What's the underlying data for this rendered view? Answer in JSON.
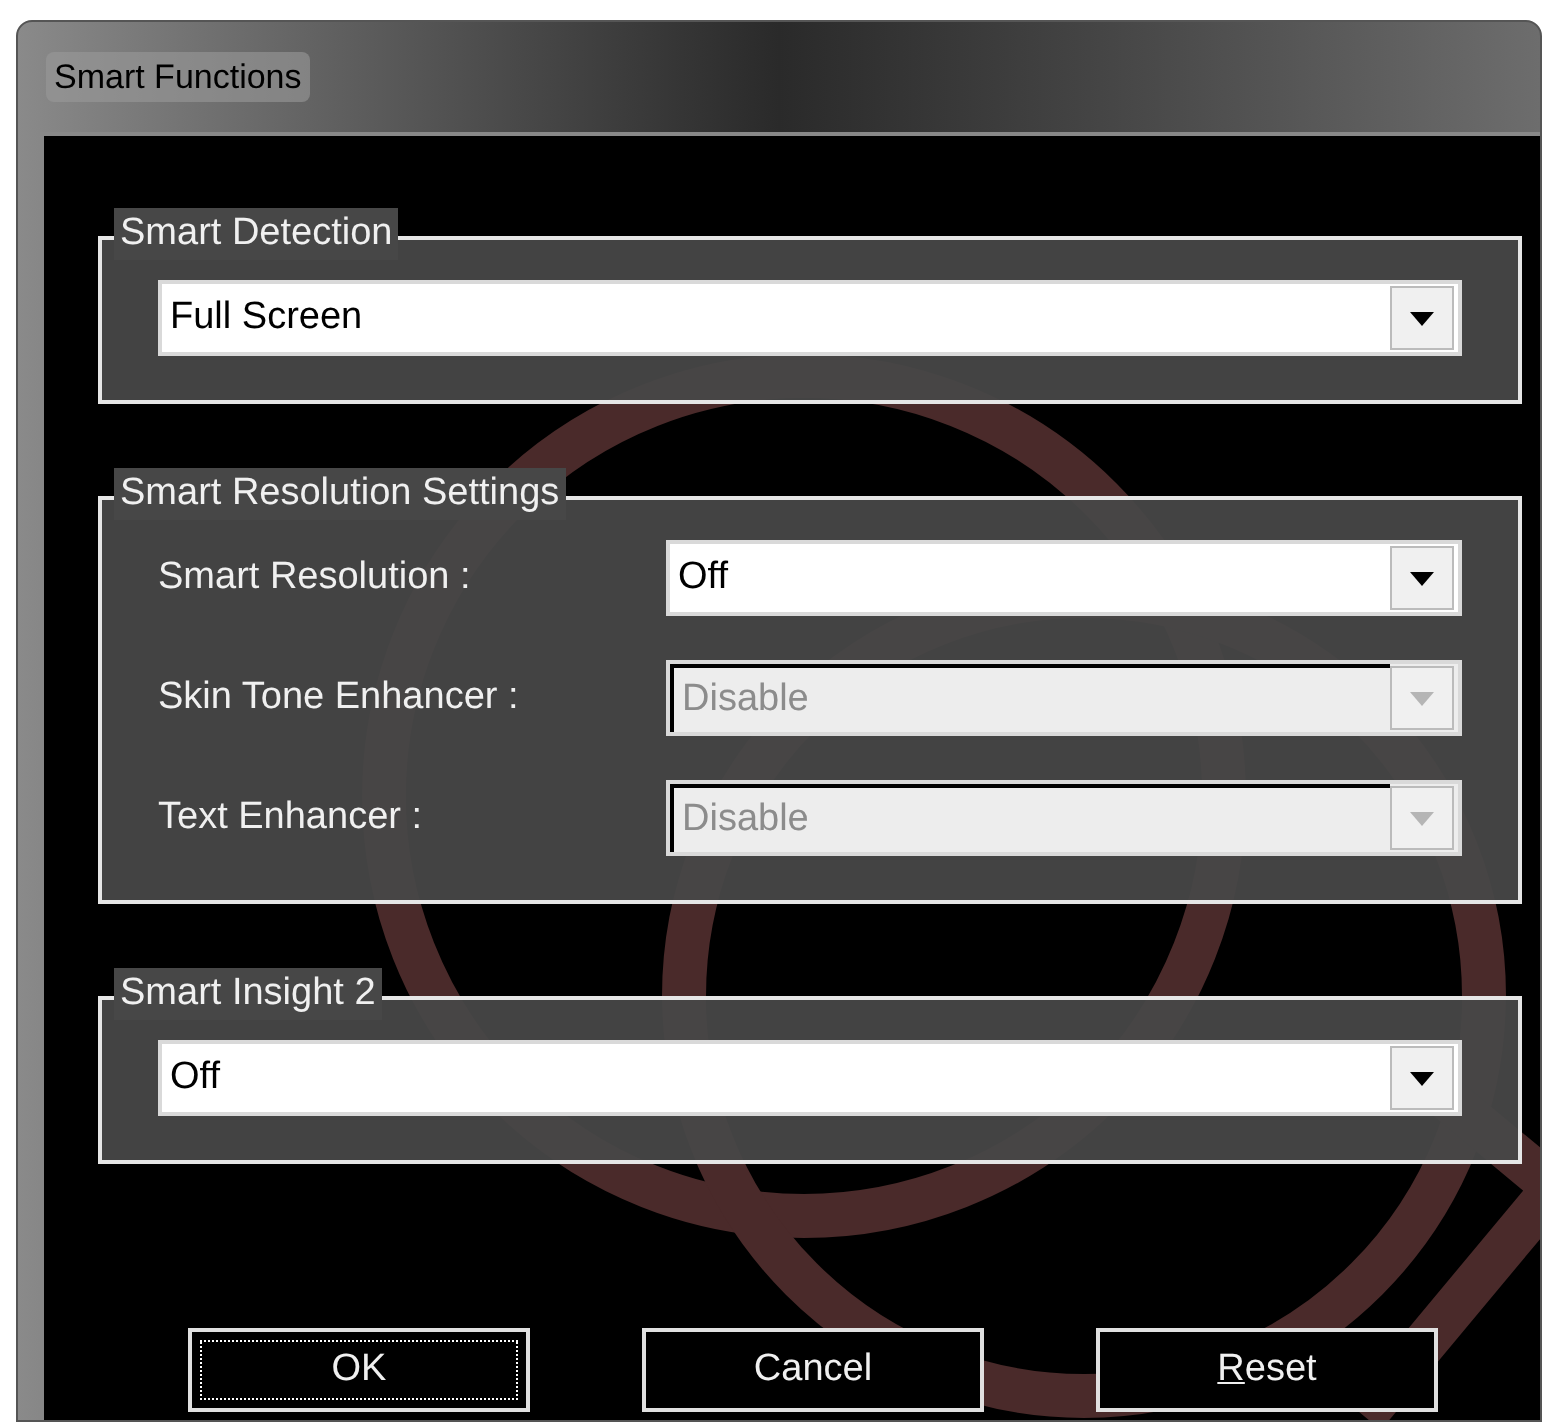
{
  "window": {
    "title": "Smart Functions"
  },
  "groups": [
    {
      "title": "Smart Detection",
      "rows": [
        {
          "value": "Full Screen",
          "disabled": false
        }
      ]
    },
    {
      "title": "Smart Resolution Settings",
      "rows": [
        {
          "label": "Smart Resolution :",
          "value": "Off",
          "disabled": false
        },
        {
          "label": "Skin Tone Enhancer :",
          "value": "Disable",
          "disabled": true
        },
        {
          "label": "Text Enhancer :",
          "value": "Disable",
          "disabled": true
        }
      ]
    },
    {
      "title": "Smart Insight 2",
      "rows": [
        {
          "value": "Off",
          "disabled": false
        }
      ]
    }
  ],
  "buttons": [
    {
      "label": "OK",
      "focused": true,
      "underline_first": false
    },
    {
      "label": "Cancel",
      "focused": false,
      "underline_first": false
    },
    {
      "label": "Reset",
      "focused": false,
      "underline_first": true
    }
  ]
}
